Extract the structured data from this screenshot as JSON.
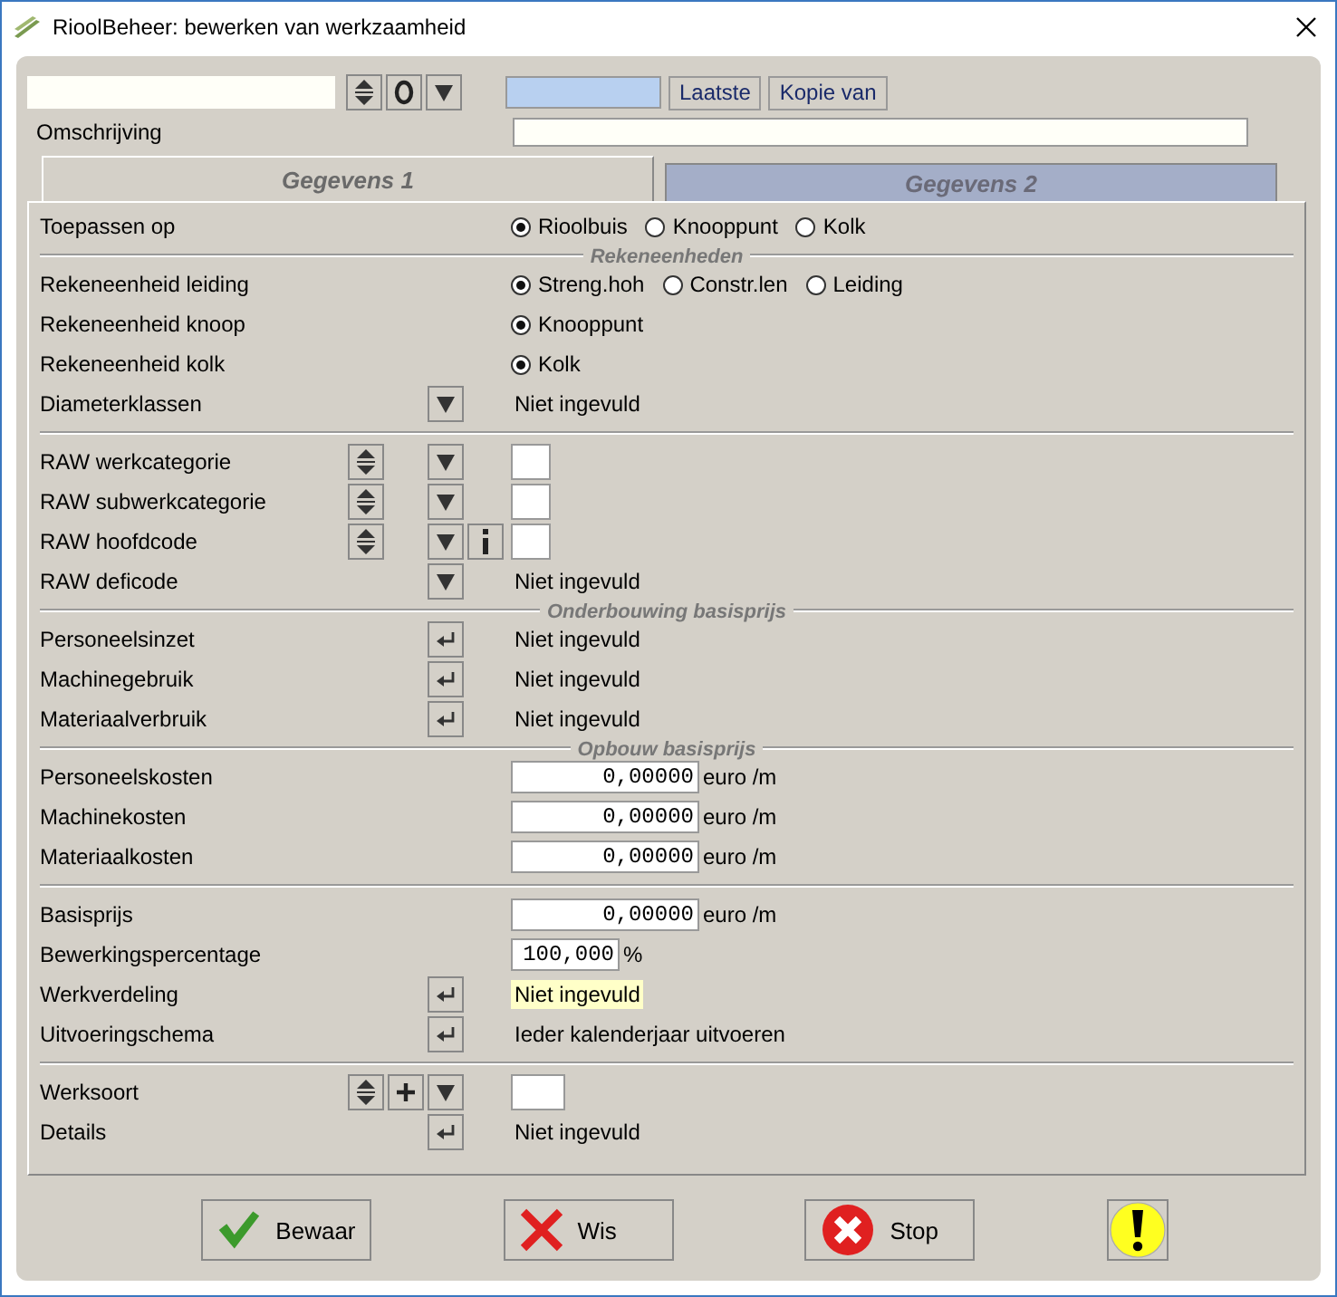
{
  "window": {
    "title": "RioolBeheer: bewerken van werkzaamheid"
  },
  "top": {
    "buttons": [
      "Laatste",
      "Kopie van"
    ],
    "description": {
      "label": "Omschrijving"
    }
  },
  "tabs": [
    {
      "label": "Gegevens 1",
      "selected": true
    },
    {
      "label": "Gegevens 2",
      "selected": false
    }
  ],
  "sections": [
    {
      "rows": [
        {
          "label": "Toepassen op",
          "kind": "radio",
          "controls": [],
          "options": [
            {
              "label": "Rioolbuis",
              "selected": true
            },
            {
              "label": "Knooppunt",
              "selected": false
            },
            {
              "label": "Kolk",
              "selected": false
            }
          ]
        }
      ]
    },
    {
      "title": "Rekeneenheden",
      "rows": [
        {
          "label": "Rekeneenheid leiding",
          "kind": "radio",
          "controls": [],
          "options": [
            {
              "label": "Streng.hoh",
              "selected": true
            },
            {
              "label": "Constr.len",
              "selected": false
            },
            {
              "label": "Leiding",
              "selected": false
            }
          ]
        },
        {
          "label": "Rekeneenheid knoop",
          "kind": "radio",
          "controls": [],
          "options": [
            {
              "label": "Knooppunt",
              "selected": true
            }
          ]
        },
        {
          "label": "Rekeneenheid kolk",
          "kind": "radio",
          "controls": [],
          "options": [
            {
              "label": "Kolk",
              "selected": true
            }
          ]
        },
        {
          "label": "Diameterklassen",
          "kind": "text",
          "controls": [
            {
              "kind": "dropdown"
            }
          ],
          "value": "Niet ingevuld",
          "highlighted": false
        }
      ]
    },
    {
      "rows": [
        {
          "label": "RAW werkcategorie",
          "kind": "box",
          "controls": [
            {
              "kind": "spin"
            },
            {
              "kind": "dropdown"
            }
          ]
        },
        {
          "label": "RAW subwerkcategorie",
          "kind": "box",
          "controls": [
            {
              "kind": "spin"
            },
            {
              "kind": "dropdown"
            }
          ]
        },
        {
          "label": "RAW hoofdcode",
          "kind": "box",
          "controls": [
            {
              "kind": "spin"
            },
            {
              "kind": "dropdown"
            },
            {
              "kind": "info"
            }
          ]
        },
        {
          "label": "RAW deficode",
          "kind": "text",
          "controls": [
            {
              "kind": "dropdown"
            }
          ],
          "value": "Niet ingevuld",
          "highlighted": false
        }
      ]
    },
    {
      "title": "Onderbouwing basisprijs",
      "rows": [
        {
          "label": "Personeelsinzet",
          "kind": "text",
          "controls": [
            {
              "kind": "enter"
            }
          ],
          "value": "Niet ingevuld",
          "highlighted": false
        },
        {
          "label": "Machinegebruik",
          "kind": "text",
          "controls": [
            {
              "kind": "enter"
            }
          ],
          "value": "Niet ingevuld",
          "highlighted": false
        },
        {
          "label": "Materiaalverbruik",
          "kind": "text",
          "controls": [
            {
              "kind": "enter"
            }
          ],
          "value": "Niet ingevuld",
          "highlighted": false
        }
      ]
    },
    {
      "title": "Opbouw basisprijs",
      "rows": [
        {
          "label": "Personeelskosten",
          "kind": "number",
          "controls": [],
          "value": "0,00000",
          "unit": "euro /m"
        },
        {
          "label": "Machinekosten",
          "kind": "number",
          "controls": [],
          "value": "0,00000",
          "unit": "euro /m"
        },
        {
          "label": "Materiaalkosten",
          "kind": "number",
          "controls": [],
          "value": "0,00000",
          "unit": "euro /m"
        }
      ]
    },
    {
      "rows": [
        {
          "label": "Basisprijs",
          "kind": "number",
          "controls": [],
          "value": "0,00000",
          "unit": "euro /m"
        },
        {
          "label": "Bewerkingspercentage",
          "kind": "percent",
          "controls": [],
          "value": "100,000",
          "unit": "%"
        },
        {
          "label": "Werkverdeling",
          "kind": "text",
          "controls": [
            {
              "kind": "enter"
            }
          ],
          "value": "Niet ingevuld",
          "highlighted": true
        },
        {
          "label": "Uitvoeringschema",
          "kind": "text",
          "controls": [
            {
              "kind": "enter"
            }
          ],
          "value": "Ieder kalenderjaar uitvoeren",
          "highlighted": false
        }
      ]
    },
    {
      "rows": [
        {
          "label": "Werksoort",
          "kind": "wide-box",
          "controls": [
            {
              "kind": "spin"
            },
            {
              "kind": "add"
            },
            {
              "kind": "dropdown"
            }
          ]
        },
        {
          "label": "Details",
          "kind": "text",
          "controls": [
            {
              "kind": "enter"
            }
          ],
          "value": "Niet ingevuld",
          "highlighted": false
        }
      ]
    }
  ],
  "actions": [
    {
      "kind": "save",
      "label": "Bewaar"
    },
    {
      "kind": "clear",
      "label": "Wis"
    },
    {
      "kind": "stop",
      "label": "Stop"
    },
    {
      "kind": "alert"
    }
  ]
}
